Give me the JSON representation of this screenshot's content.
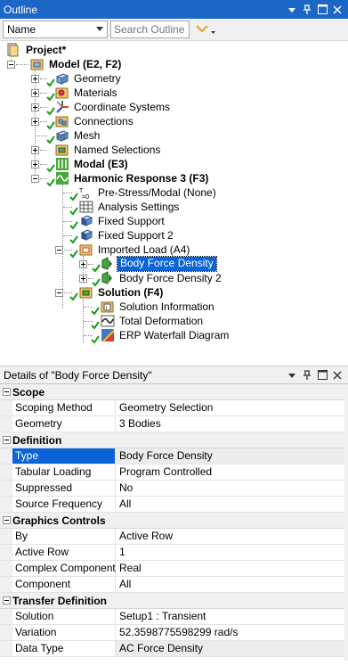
{
  "outline": {
    "title": "Outline",
    "name_filter": "Name",
    "search_placeholder": "Search Outline",
    "tree": {
      "project": "Project*",
      "model": "Model (E2, F2)",
      "geometry": "Geometry",
      "materials": "Materials",
      "coordinate_systems": "Coordinate Systems",
      "connections": "Connections",
      "mesh": "Mesh",
      "named_selections": "Named Selections",
      "modal": "Modal (E3)",
      "harmonic_response": "Harmonic Response 3 (F3)",
      "pre_stress": "Pre-Stress/Modal (None)",
      "analysis_settings": "Analysis Settings",
      "fixed_support": "Fixed Support",
      "fixed_support_2": "Fixed Support 2",
      "imported_load": "Imported Load (A4)",
      "body_force_density": "Body Force Density",
      "body_force_density_2": "Body Force Density 2",
      "solution": "Solution (F4)",
      "solution_information": "Solution Information",
      "total_deformation": "Total Deformation",
      "erp_waterfall": "ERP Waterfall Diagram"
    }
  },
  "details": {
    "title": "Details of \"Body Force Density\"",
    "groups": {
      "scope": "Scope",
      "definition": "Definition",
      "graphics_controls": "Graphics Controls",
      "transfer_definition": "Transfer Definition"
    },
    "rows": {
      "scoping_method": {
        "k": "Scoping Method",
        "v": "Geometry Selection"
      },
      "geometry": {
        "k": "Geometry",
        "v": "3 Bodies"
      },
      "type": {
        "k": "Type",
        "v": "Body Force Density"
      },
      "tabular_loading": {
        "k": "Tabular Loading",
        "v": "Program Controlled"
      },
      "suppressed": {
        "k": "Suppressed",
        "v": "No"
      },
      "source_frequency": {
        "k": "Source Frequency",
        "v": "All"
      },
      "by": {
        "k": "By",
        "v": "Active Row"
      },
      "active_row": {
        "k": "Active Row",
        "v": "1"
      },
      "complex_component": {
        "k": "Complex Component",
        "v": "Real"
      },
      "component": {
        "k": "Component",
        "v": "All"
      },
      "solution": {
        "k": "Solution",
        "v": "Setup1 : Transient"
      },
      "variation": {
        "k": "Variation",
        "v": "52.3598775598299 rad/s"
      },
      "data_type": {
        "k": "Data Type",
        "v": "AC Force Density"
      }
    }
  },
  "colors": {
    "titlebar": "#1c66c5",
    "selection": "#0a64d8",
    "check": "#1a9a1a"
  }
}
